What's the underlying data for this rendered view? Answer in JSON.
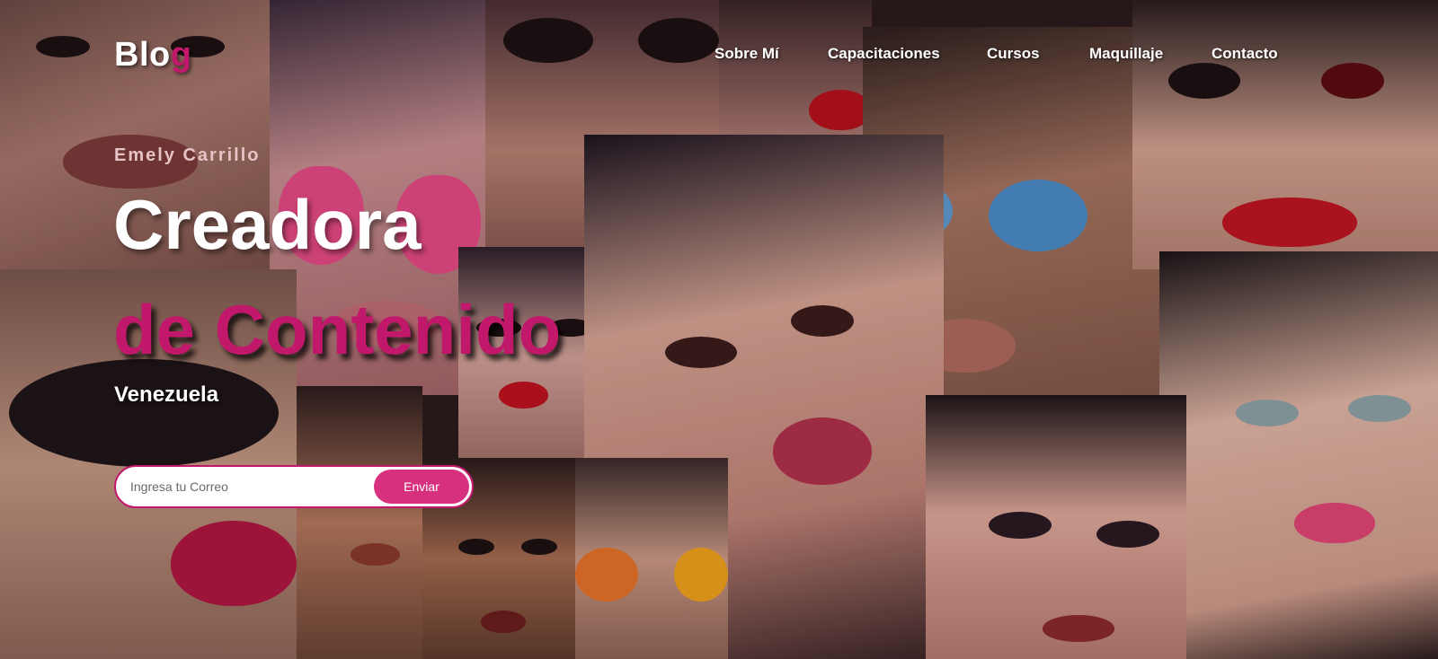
{
  "header": {
    "logo_main": "Blo",
    "logo_accent": "g",
    "nav": [
      {
        "label": "Sobre Mí"
      },
      {
        "label": "Capacitaciones"
      },
      {
        "label": "Cursos"
      },
      {
        "label": "Maquillaje"
      },
      {
        "label": "Contacto"
      }
    ]
  },
  "hero": {
    "name": "Emely Carrillo",
    "headline_line1": "Creadora",
    "headline_line2": "de Contenido",
    "location": "Venezuela"
  },
  "subscribe": {
    "placeholder": "Ingresa tu Correo",
    "button_label": "Enviar"
  },
  "colors": {
    "accent": "#c2186b",
    "button": "#d6307e",
    "text": "#ffffff"
  }
}
